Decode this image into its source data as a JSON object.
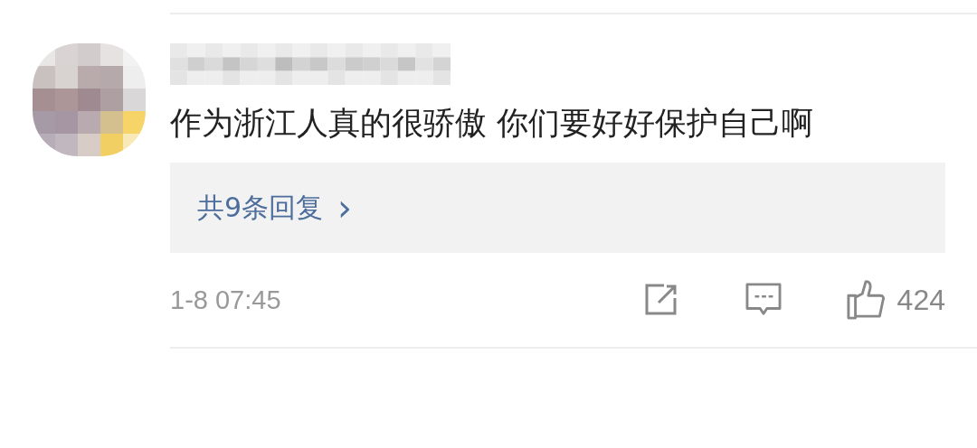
{
  "comment": {
    "text": "作为浙江人真的很骄傲 你们要好好保护自己啊",
    "replies_link": "共9条回复",
    "replies_arrow": "›",
    "time": "1-8 07:45",
    "like_count": "424"
  }
}
